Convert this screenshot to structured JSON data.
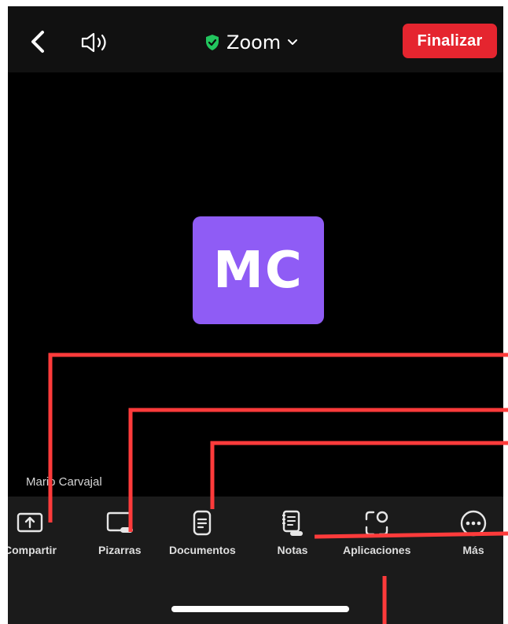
{
  "header": {
    "title": "Zoom",
    "end_label": "Finalizar",
    "secure_color": "#22c55e",
    "end_color": "#e5252f"
  },
  "meeting": {
    "avatar_initials": "MC",
    "avatar_color": "#8f5cf5",
    "participant_name": "Mario Carvajal"
  },
  "toolbar": {
    "items": [
      {
        "label": "Compartir",
        "icon": "share-screen-icon"
      },
      {
        "label": "Pizarras",
        "icon": "whiteboard-icon"
      },
      {
        "label": "Documentos",
        "icon": "document-icon"
      },
      {
        "label": "Notas",
        "icon": "notes-icon"
      },
      {
        "label": "Aplicaciones",
        "icon": "apps-icon"
      },
      {
        "label": "Más",
        "icon": "more-icon"
      }
    ]
  },
  "annotation_color": "#ff3b3b"
}
